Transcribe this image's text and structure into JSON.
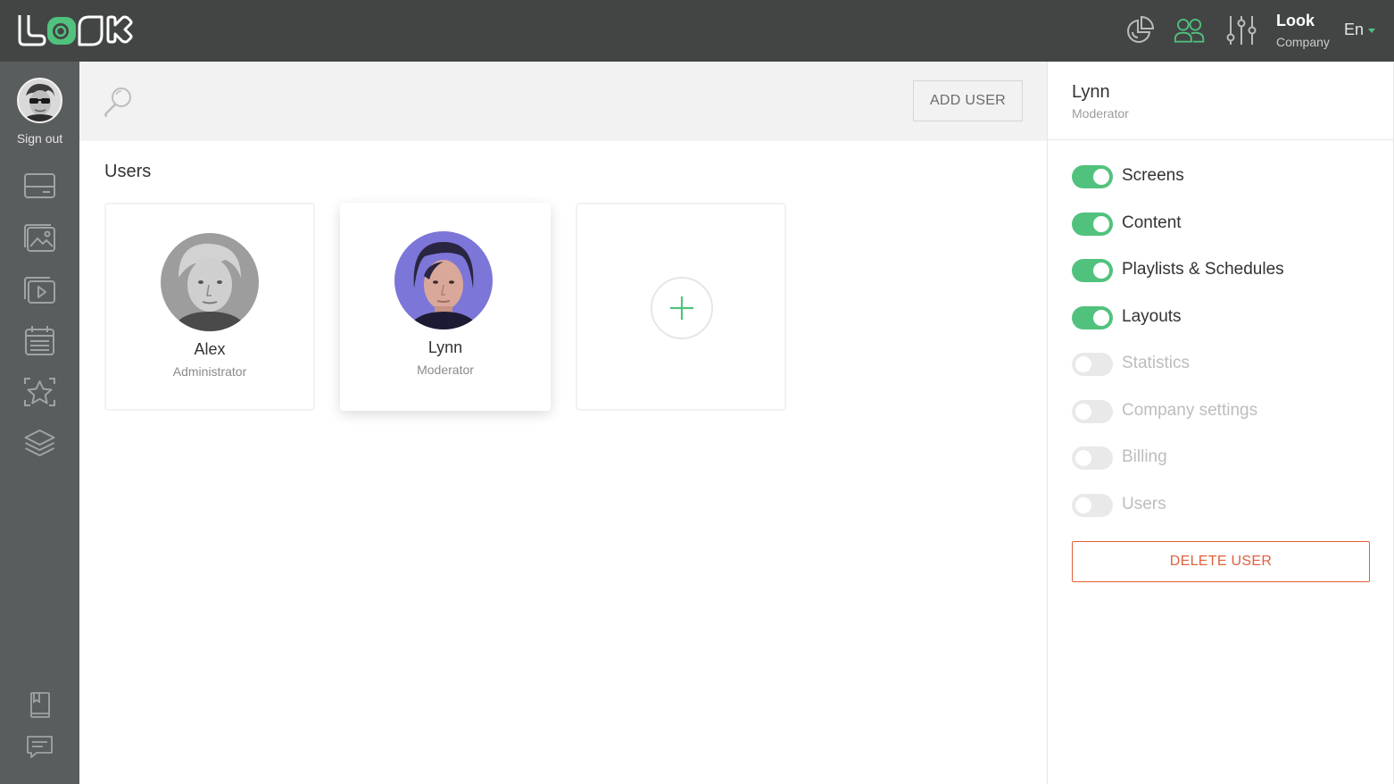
{
  "topbar": {
    "logo_text": "LOOK",
    "company": {
      "name": "Look",
      "subtitle": "Company"
    },
    "language": "En",
    "icons": [
      "pie-chart-icon",
      "users-icon",
      "sliders-icon"
    ]
  },
  "sidebar": {
    "sign_out_label": "Sign out",
    "items": [
      "screens-icon",
      "content-icon",
      "playlists-icon",
      "schedules-icon",
      "layouts-icon",
      "layers-icon"
    ],
    "bottom_items": [
      "docs-icon",
      "chat-icon"
    ]
  },
  "main": {
    "add_user_label": "ADD USER",
    "section_title": "Users",
    "users": [
      {
        "name": "Alex",
        "role": "Administrator",
        "selected": false
      },
      {
        "name": "Lynn",
        "role": "Moderator",
        "selected": true
      }
    ]
  },
  "panel": {
    "name": "Lynn",
    "role": "Moderator",
    "permissions": [
      {
        "label": "Screens",
        "enabled": true
      },
      {
        "label": "Content",
        "enabled": true
      },
      {
        "label": "Playlists & Schedules",
        "enabled": true
      },
      {
        "label": "Layouts",
        "enabled": true
      },
      {
        "label": "Statistics",
        "enabled": false
      },
      {
        "label": "Company settings",
        "enabled": false
      },
      {
        "label": "Billing",
        "enabled": false
      },
      {
        "label": "Users",
        "enabled": false
      }
    ],
    "delete_label": "DELETE USER"
  },
  "colors": {
    "accent": "#51c27d",
    "danger": "#e0603c",
    "topbar": "#434545",
    "sidebar": "#5a5d5d"
  }
}
